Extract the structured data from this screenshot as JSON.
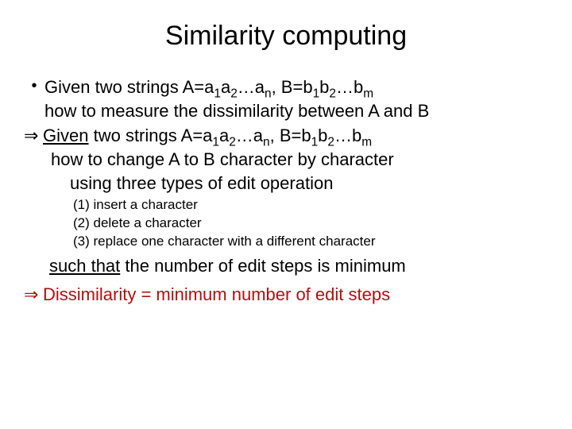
{
  "title": "Similarity computing",
  "line1_pre": "Given two strings A=a",
  "sub1": "1",
  "line1_a2": "a",
  "sub2": "2",
  "line1_dots": "…a",
  "subn": "n",
  "line1_comma": ", B=b",
  "sub1b": "1",
  "line1_b2": "b",
  "sub2b": "2",
  "line1_dotsb": "…b",
  "subm": "m",
  "line2": "how to measure the dissimilarity between A and B",
  "line3_given": "Given",
  "line3_rest_pre": " two strings A=a",
  "line3_a2": "a",
  "line3_dots": "…a",
  "line3_comma": ", B=b",
  "line3_b2": "b",
  "line3_dotsb": "…b",
  "line4": "how to change A to B character by character",
  "line5": "using three types of edit operation",
  "op1": "(1) insert a character",
  "op2": "(2) delete a character",
  "op3": "(3) replace one character with a different character",
  "such_that_u": "such that",
  "such_that_rest": " the number of edit steps is minimum",
  "final": "Dissimilarity = minimum number of edit steps",
  "bullet": "•",
  "arrow": "⇒"
}
